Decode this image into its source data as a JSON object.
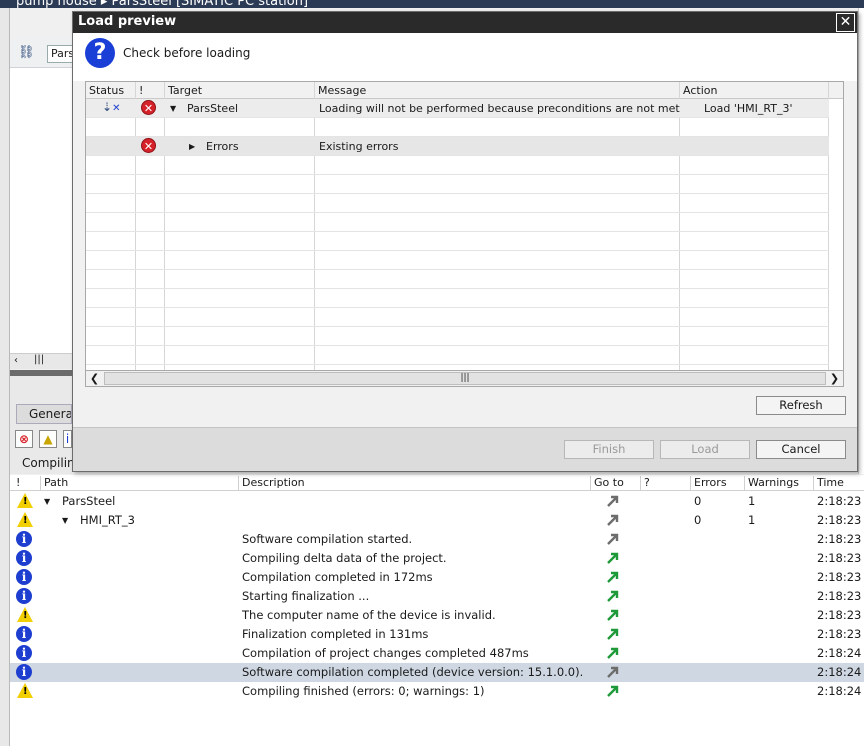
{
  "app": {
    "title": "pump house  ▸  ParsSteel [SIMATIC PC station]",
    "search_value": "Pars",
    "tab_general": "Genera",
    "compiling_label": "Compilin"
  },
  "dialog": {
    "title": "Load preview",
    "heading": "Check before loading",
    "columns": {
      "status": "Status",
      "excl": "!",
      "target": "Target",
      "message": "Message",
      "action": "Action"
    },
    "rows": [
      {
        "target": "ParsSteel",
        "message": "Loading will not be performed because preconditions are not met",
        "action": "Load 'HMI_RT_3'"
      },
      {
        "target": "Errors",
        "message": "Existing errors",
        "action": ""
      }
    ],
    "scroll_thumb_grip": "|||",
    "refresh_label": "Refresh",
    "finish_label": "Finish",
    "load_label": "Load",
    "cancel_label": "Cancel",
    "close_glyph": "✕"
  },
  "messages": {
    "columns": {
      "excl": "!",
      "path": "Path",
      "description": "Description",
      "goto": "Go to",
      "q": "?",
      "errors": "Errors",
      "warnings": "Warnings",
      "time": "Time"
    },
    "rows": [
      {
        "icon": "warning-icon",
        "path": "ParsSteel",
        "description": "",
        "errors": "0",
        "warnings": "1",
        "time": "2:18:23"
      },
      {
        "icon": "warning-icon",
        "path": "HMI_RT_3",
        "description": "",
        "errors": "0",
        "warnings": "1",
        "time": "2:18:23"
      },
      {
        "icon": "info-icon",
        "path": "",
        "description": "Software compilation started.",
        "errors": "",
        "warnings": "",
        "time": "2:18:23"
      },
      {
        "icon": "info-icon",
        "path": "",
        "description": "Compiling delta data of the project.",
        "errors": "",
        "warnings": "",
        "time": "2:18:23"
      },
      {
        "icon": "info-icon",
        "path": "",
        "description": "Compilation completed in 172ms",
        "errors": "",
        "warnings": "",
        "time": "2:18:23"
      },
      {
        "icon": "info-icon",
        "path": "",
        "description": "Starting finalization ...",
        "errors": "",
        "warnings": "",
        "time": "2:18:23"
      },
      {
        "icon": "warning-icon",
        "path": "",
        "description": "The computer name of the device is invalid.",
        "errors": "",
        "warnings": "",
        "time": "2:18:23"
      },
      {
        "icon": "info-icon",
        "path": "",
        "description": "Finalization completed in 131ms",
        "errors": "",
        "warnings": "",
        "time": "2:18:23"
      },
      {
        "icon": "info-icon",
        "path": "",
        "description": "Compilation of project changes completed 487ms",
        "errors": "",
        "warnings": "",
        "time": "2:18:24"
      },
      {
        "icon": "info-icon",
        "path": "",
        "description": "Software compilation completed (device version: 15.1.0.0).",
        "errors": "",
        "warnings": "",
        "time": "2:18:24"
      },
      {
        "icon": "warning-icon",
        "path": "",
        "description": "Compiling finished (errors: 0; warnings: 1)",
        "errors": "",
        "warnings": "",
        "time": "2:18:24"
      }
    ]
  }
}
